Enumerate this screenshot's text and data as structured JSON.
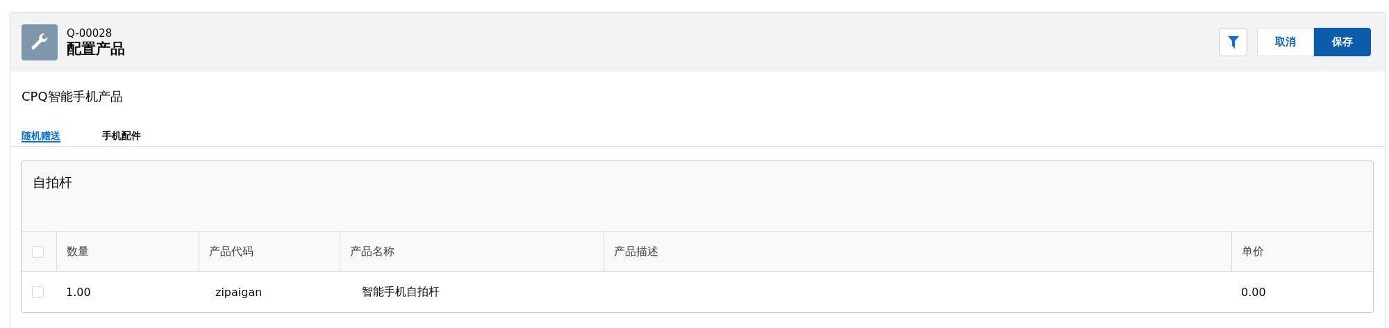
{
  "header": {
    "record_number": "Q-00028",
    "title": "配置产品",
    "buttons": [
      {
        "label": "取消",
        "kind": "neutral"
      },
      {
        "label": "保存",
        "kind": "brand"
      }
    ]
  },
  "bundle_name": "CPQ智能手机产品",
  "tabs": [
    {
      "label": "随机赠送",
      "selected": true
    },
    {
      "label": "手机配件",
      "selected": false
    }
  ],
  "section": {
    "title": "自拍杆",
    "select_all": {
      "checked": false
    },
    "columns": [
      "数量",
      "产品代码",
      "产品名称",
      "产品描述",
      "单价"
    ],
    "rows": [
      {
        "checked": false,
        "cells": [
          "1.00",
          "zipaigan",
          "智能手机自拍杆",
          null,
          "0.00"
        ]
      }
    ]
  }
}
